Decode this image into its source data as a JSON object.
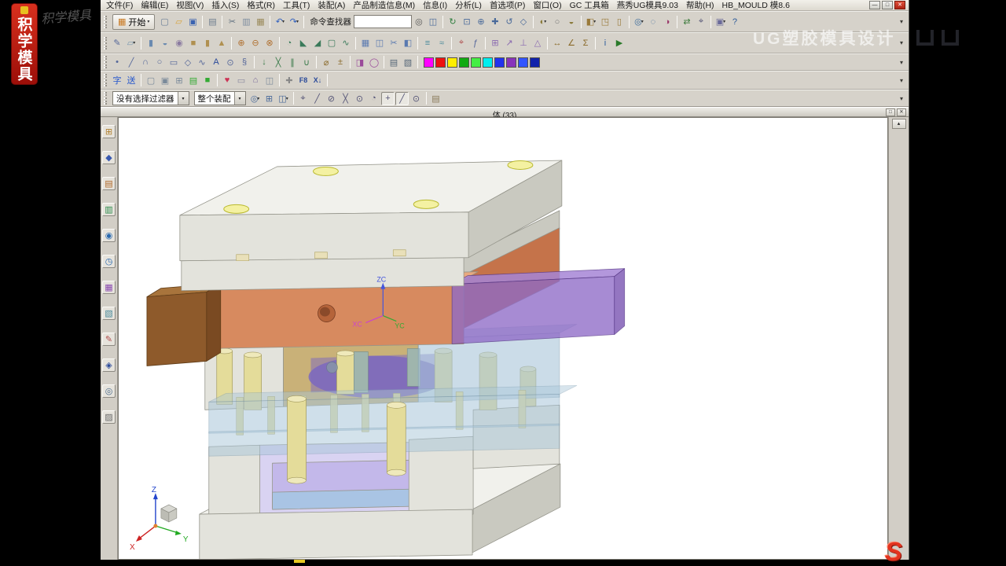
{
  "window": {
    "menus": [
      {
        "label": "文件(F)"
      },
      {
        "label": "编辑(E)"
      },
      {
        "label": "视图(V)"
      },
      {
        "label": "插入(S)"
      },
      {
        "label": "格式(R)"
      },
      {
        "label": "工具(T)"
      },
      {
        "label": "装配(A)"
      },
      {
        "label": "产品制造信息(M)"
      },
      {
        "label": "信息(I)"
      },
      {
        "label": "分析(L)"
      },
      {
        "label": "首选项(P)"
      },
      {
        "label": "窗口(O)"
      },
      {
        "label": "GC 工具箱"
      },
      {
        "label": "燕秀UG模具9.03"
      },
      {
        "label": "帮助(H)"
      },
      {
        "label": "HB_MOULD 模8.6"
      }
    ],
    "controls": {
      "minimize": "—",
      "maximize": "□",
      "close": "✕"
    }
  },
  "brand": {
    "banner_text": "积学模具",
    "script_text": "积学模具"
  },
  "watermark_text": "UG塑胶模具设计",
  "toolbars": {
    "overflow_glyph": "▾",
    "start_button": {
      "glyph": "▦",
      "label": "开始"
    },
    "command_finder": {
      "label": "命令查找器",
      "value": "",
      "icon_glyph": "◎"
    },
    "row1a": [
      {
        "n": "new-file-icon",
        "g": "▢",
        "c": "#6b7f98"
      },
      {
        "n": "open-icon",
        "g": "▱",
        "c": "#d9a33b"
      },
      {
        "n": "save-icon",
        "g": "▣",
        "c": "#3a62b0"
      },
      {
        "t": "sep"
      },
      {
        "n": "print-icon",
        "g": "▤",
        "c": "#6e7e8e"
      },
      {
        "t": "sep"
      },
      {
        "n": "cut-icon",
        "g": "✂",
        "c": "#5f6f7f"
      },
      {
        "n": "copy-icon",
        "g": "▥",
        "c": "#7d8da0"
      },
      {
        "n": "paste-icon",
        "g": "▦",
        "c": "#9a8a5a"
      },
      {
        "t": "sep"
      },
      {
        "n": "undo-icon",
        "g": "↶",
        "c": "#2f5fbf",
        "caret": true
      },
      {
        "n": "redo-icon",
        "g": "↷",
        "c": "#2f5fbf",
        "caret": true
      },
      {
        "t": "sep"
      }
    ],
    "row1b": [
      {
        "n": "touch-mode-icon",
        "g": "◫",
        "c": "#4a6a9a"
      },
      {
        "t": "sep"
      },
      {
        "n": "refresh-view-icon",
        "g": "↻",
        "c": "#2f7f3f"
      },
      {
        "n": "fit-view-icon",
        "g": "⊡",
        "c": "#4a6a9a"
      },
      {
        "n": "zoom-icon",
        "g": "⊕",
        "c": "#4a6a9a"
      },
      {
        "n": "pan-view-icon",
        "g": "✚",
        "c": "#4a6a9a"
      },
      {
        "n": "rotate-view-icon",
        "g": "↺",
        "c": "#4a6a9a"
      },
      {
        "n": "perspective-icon",
        "g": "◇",
        "c": "#4a6a9a"
      },
      {
        "t": "sep"
      },
      {
        "n": "shaded-mode-icon",
        "g": "◐",
        "c": "#8a7a3a",
        "caret": true
      },
      {
        "n": "wireframe-mode-icon",
        "g": "○",
        "c": "#777777"
      },
      {
        "n": "render-style-icon",
        "g": "◒",
        "c": "#8a7a3a"
      },
      {
        "t": "sep"
      },
      {
        "n": "orient-view-icon",
        "g": "◧",
        "c": "#9a7a3a",
        "caret": true
      },
      {
        "n": "trimetric-view-icon",
        "g": "◳",
        "c": "#9a7a3a"
      },
      {
        "n": "front-view-icon",
        "g": "▯",
        "c": "#9a7a3a"
      },
      {
        "t": "sep"
      },
      {
        "n": "show-hide-icon",
        "g": "◎",
        "c": "#3a6a9a",
        "caret": true
      },
      {
        "n": "immediate-hide-icon",
        "g": "◌",
        "c": "#3a6a9a"
      },
      {
        "n": "edit-object-display-icon",
        "g": "◑",
        "c": "#9a3a6a"
      },
      {
        "t": "sep"
      },
      {
        "n": "move-object-icon",
        "g": "⇄",
        "c": "#3a7a3a"
      },
      {
        "n": "snap-point-icon",
        "g": "⌖",
        "c": "#555577"
      },
      {
        "t": "sep"
      },
      {
        "n": "window-icon",
        "g": "▣",
        "c": "#6a6a9a",
        "caret": true
      },
      {
        "n": "help-icon",
        "g": "?",
        "c": "#2a5a9a"
      }
    ],
    "row2": [
      {
        "n": "sketch-icon",
        "g": "✎",
        "c": "#55679a"
      },
      {
        "n": "datum-plane-icon",
        "g": "▱",
        "c": "#7a9ab0",
        "caret": true
      },
      {
        "t": "sep"
      },
      {
        "n": "extrude-icon",
        "g": "▮",
        "c": "#6a8ab0"
      },
      {
        "n": "revolve-icon",
        "g": "◒",
        "c": "#6a8ab0"
      },
      {
        "n": "hole-icon",
        "g": "◉",
        "c": "#8a7aa0"
      },
      {
        "n": "block-icon",
        "g": "■",
        "c": "#b09050"
      },
      {
        "n": "cylinder-icon",
        "g": "▮",
        "c": "#b09050"
      },
      {
        "n": "cone-icon",
        "g": "▲",
        "c": "#b09050"
      },
      {
        "t": "sep"
      },
      {
        "n": "unite-icon",
        "g": "⊕",
        "c": "#b07030"
      },
      {
        "n": "subtract-icon",
        "g": "⊖",
        "c": "#b07030"
      },
      {
        "n": "intersect-icon",
        "g": "⊗",
        "c": "#b07030"
      },
      {
        "t": "sep"
      },
      {
        "n": "edge-blend-icon",
        "g": "◔",
        "c": "#3a7a5a"
      },
      {
        "n": "chamfer-icon",
        "g": "◣",
        "c": "#3a7a5a"
      },
      {
        "n": "draft-icon",
        "g": "◢",
        "c": "#3a7a5a"
      },
      {
        "n": "shell-icon",
        "g": "▢",
        "c": "#3a7a5a"
      },
      {
        "n": "thread-icon",
        "g": "∿",
        "c": "#3a7a5a"
      },
      {
        "t": "sep"
      },
      {
        "n": "pattern-feature-icon",
        "g": "▦",
        "c": "#5a7ab0"
      },
      {
        "n": "mirror-feature-icon",
        "g": "◫",
        "c": "#5a7ab0"
      },
      {
        "n": "trim-body-icon",
        "g": "✂",
        "c": "#5a7ab0"
      },
      {
        "n": "split-body-icon",
        "g": "◧",
        "c": "#5a7ab0"
      },
      {
        "t": "sep"
      },
      {
        "n": "offset-surface-icon",
        "g": "≡",
        "c": "#4a8a9a"
      },
      {
        "n": "wave-link-icon",
        "g": "≈",
        "c": "#4a8a9a"
      },
      {
        "t": "sep"
      },
      {
        "n": "datum-csys-icon",
        "g": "⌖",
        "c": "#b05050"
      },
      {
        "n": "expressions-icon",
        "g": "ƒ",
        "c": "#55679a"
      },
      {
        "t": "sep"
      },
      {
        "n": "add-component-icon",
        "g": "⊞",
        "c": "#8a6ab0"
      },
      {
        "n": "move-component-icon",
        "g": "↗",
        "c": "#8a6ab0"
      },
      {
        "n": "assembly-constraints-icon",
        "g": "⊥",
        "c": "#8a6ab0"
      },
      {
        "n": "exploded-view-icon",
        "g": "△",
        "c": "#8a6ab0"
      },
      {
        "t": "sep"
      },
      {
        "n": "measure-distance-icon",
        "g": "↔",
        "c": "#8a6a2a"
      },
      {
        "n": "measure-angle-icon",
        "g": "∠",
        "c": "#8a6a2a"
      },
      {
        "n": "simple-analysis-icon",
        "g": "Σ",
        "c": "#8a6a2a"
      },
      {
        "t": "sep"
      },
      {
        "n": "info-icon",
        "g": "i",
        "c": "#2a5a9a"
      },
      {
        "n": "play-icon",
        "g": "▶",
        "c": "#2a7a2a"
      }
    ],
    "row3": [
      {
        "n": "point-icon",
        "g": "•",
        "c": "#55679a"
      },
      {
        "n": "line-icon",
        "g": "╱",
        "c": "#55679a"
      },
      {
        "n": "arc-icon",
        "g": "∩",
        "c": "#55679a"
      },
      {
        "n": "circle-icon",
        "g": "○",
        "c": "#55679a"
      },
      {
        "n": "rectangle-icon",
        "g": "▭",
        "c": "#55679a"
      },
      {
        "n": "polygon-icon",
        "g": "◇",
        "c": "#55679a"
      },
      {
        "n": "studio-spline-icon",
        "g": "∿",
        "c": "#55679a"
      },
      {
        "n": "text-curve-icon",
        "g": "A",
        "c": "#2a4a9a"
      },
      {
        "n": "ellipse-icon",
        "g": "⊙",
        "c": "#55679a"
      },
      {
        "n": "helix-icon",
        "g": "§",
        "c": "#55679a"
      },
      {
        "t": "sep"
      },
      {
        "n": "project-curve-icon",
        "g": "↓",
        "c": "#3a7a4a"
      },
      {
        "n": "intersection-curve-icon",
        "g": "╳",
        "c": "#3a7a4a"
      },
      {
        "n": "offset-curve-icon",
        "g": "∥",
        "c": "#3a7a4a"
      },
      {
        "n": "bridge-curve-icon",
        "g": "∪",
        "c": "#3a7a4a"
      },
      {
        "t": "sep"
      },
      {
        "n": "measure-body-icon",
        "g": "⌀",
        "c": "#8a6a2a"
      },
      {
        "n": "deviation-gauge-icon",
        "g": "±",
        "c": "#8a6a2a"
      },
      {
        "t": "sep"
      },
      {
        "n": "object-display-icon",
        "g": "◨",
        "c": "#9a4a9a"
      },
      {
        "n": "show-object-icon",
        "g": "◯",
        "c": "#9a4a9a"
      },
      {
        "t": "sep"
      },
      {
        "n": "layer-icon",
        "g": "▤",
        "c": "#556677"
      },
      {
        "n": "visualization-icon",
        "g": "▧",
        "c": "#556677"
      },
      {
        "t": "sep"
      }
    ],
    "swatches": [
      "#ff00ff",
      "#ee1111",
      "#ffee00",
      "#11aa11",
      "#44ee44",
      "#00eeee",
      "#2233ee",
      "#8833bb",
      "#3355ff",
      "#1122aa"
    ],
    "row4": [
      {
        "n": "text-tool-icon",
        "g": "字",
        "c": "#2255cc"
      },
      {
        "n": "express-tool-icon",
        "g": "送",
        "c": "#2255cc"
      },
      {
        "t": "sep"
      },
      {
        "n": "mold-tool-frame-icon",
        "g": "▢",
        "c": "#7a8a9a"
      },
      {
        "n": "mold-tool-plate-icon",
        "g": "▣",
        "c": "#7a8a9a"
      },
      {
        "n": "mold-tool-grid-icon",
        "g": "⊞",
        "c": "#7a8a9a"
      },
      {
        "n": "mold-tool-table-icon",
        "g": "▤",
        "c": "#33aa33"
      },
      {
        "n": "mold-tool-solid-icon",
        "g": "■",
        "c": "#33aa33"
      },
      {
        "t": "sep"
      },
      {
        "n": "favorite-icon",
        "g": "♥",
        "c": "#cc3355"
      },
      {
        "n": "frame-icon",
        "g": "▭",
        "c": "#8a8aa0"
      },
      {
        "n": "home-icon",
        "g": "⌂",
        "c": "#7a6a9a"
      },
      {
        "n": "panel-icon",
        "g": "◫",
        "c": "#7a8a9a"
      },
      {
        "t": "sep"
      },
      {
        "n": "attach-icon",
        "g": "✚",
        "c": "#888888"
      },
      {
        "n": "f8-view-icon",
        "g": "F8",
        "c": "#2a4a9a",
        "wide": true
      },
      {
        "n": "x-down-icon",
        "g": "X↓",
        "c": "#2a4a9a",
        "wide": true
      },
      {
        "t": "sep"
      }
    ]
  },
  "selection_bar": {
    "filter_value": "没有选择过滤器",
    "scope_value": "整个装配",
    "icons": [
      {
        "n": "selection-scope-icon",
        "g": "◎",
        "c": "#4a6a9a",
        "caret": true
      },
      {
        "n": "select-all-icon",
        "g": "⊞",
        "c": "#4a6a9a"
      },
      {
        "n": "highlight-icon",
        "g": "◫",
        "c": "#4a6a9a",
        "caret": true
      },
      {
        "t": "sep"
      },
      {
        "n": "snap-point-toggle-icon",
        "g": "⌖",
        "c": "#555577"
      },
      {
        "n": "endpoint-snap-icon",
        "g": "╱",
        "c": "#555577"
      },
      {
        "n": "midpoint-snap-icon",
        "g": "⊘",
        "c": "#555577"
      },
      {
        "n": "intersection-snap-icon",
        "g": "╳",
        "c": "#555577"
      },
      {
        "n": "arc-center-snap-icon",
        "g": "⊙",
        "c": "#555577"
      },
      {
        "n": "quadrant-snap-icon",
        "g": "◔",
        "c": "#555577"
      },
      {
        "n": "existing-point-snap-icon",
        "g": "+",
        "c": "#555577",
        "pressed": true
      },
      {
        "n": "point-on-curve-snap-icon",
        "g": "╱",
        "c": "#555577",
        "pressed": true
      },
      {
        "n": "point-on-surface-snap-icon",
        "g": "⊙",
        "c": "#555577"
      },
      {
        "t": "sep"
      },
      {
        "n": "clipboard-icon",
        "g": "▤",
        "c": "#8a7a5a"
      }
    ]
  },
  "viewport": {
    "title": "体 (33)",
    "restore_glyph": "□",
    "close_glyph": "✕",
    "scroll_up_glyph": "▴"
  },
  "sidebar": {
    "icons": [
      {
        "n": "assembly-navigator-icon",
        "g": "⊞",
        "c": "#b08030"
      },
      {
        "n": "constraint-navigator-icon",
        "g": "◆",
        "c": "#3a5ab0"
      },
      {
        "n": "part-navigator-icon",
        "g": "▤",
        "c": "#b06a2a"
      },
      {
        "n": "reuse-library-icon",
        "g": "▥",
        "c": "#2a8a4a"
      },
      {
        "n": "web-browser-icon",
        "g": "◉",
        "c": "#2a6ab0"
      },
      {
        "n": "history-icon",
        "g": "◷",
        "c": "#2a6ab0"
      },
      {
        "n": "process-studio-icon",
        "g": "▦",
        "c": "#8a4ab0"
      },
      {
        "n": "manager-icon",
        "g": "▧",
        "c": "#4a8a9a"
      },
      {
        "n": "roles-icon",
        "g": "✎",
        "c": "#b04a4a"
      },
      {
        "n": "bookmark-icon",
        "g": "◈",
        "c": "#2a4a9a"
      },
      {
        "n": "find-icon",
        "g": "◎",
        "c": "#4a6a8a"
      },
      {
        "n": "palette-icon",
        "g": "▨",
        "c": "#6a6a6a"
      }
    ]
  },
  "model": {
    "colors": {
      "plate_top": "#f1f1ec",
      "plate_front": "#e3e3dc",
      "plate_side": "#c9c9c0",
      "hole_ring": "#f4f1a2",
      "hole_stroke": "#b9b92e",
      "orange_front": "#d78a5f",
      "orange_top": "#e9a97e",
      "orange_side": "#c5734a",
      "brown_front": "#8e5a2b",
      "brown_top": "#a8743c",
      "brown_side": "#7a4a22",
      "purple_fill": "#8f6bc7",
      "purple_top": "#a685d6",
      "purple_side": "#7a55b2",
      "glass_blue": "#a9c6d9",
      "core_tan": "#c9b178",
      "lavender": "#d9d3f2",
      "lavender2": "#c3b8ea",
      "blue_strip": "#a9c4e4",
      "pin_yellow": "#e4dc9a",
      "pin_cap": "#efe9bb",
      "pin_gray": "#9fb5ad",
      "inner_purple": "#7b68c0",
      "hole_dark": "#b5643a",
      "axis_x": "#cc2222",
      "axis_y": "#22aa22",
      "axis_z": "#2244cc",
      "wcs_xc": "#cc44cc",
      "wcs_yc": "#33aa33",
      "wcs_zc": "#4455dd"
    },
    "wcs_labels": {
      "zc": "ZC",
      "xc": "XC",
      "yc": "YC"
    },
    "triad_labels": {
      "x": "X",
      "y": "Y",
      "z": "Z"
    }
  },
  "logo_s": "S"
}
